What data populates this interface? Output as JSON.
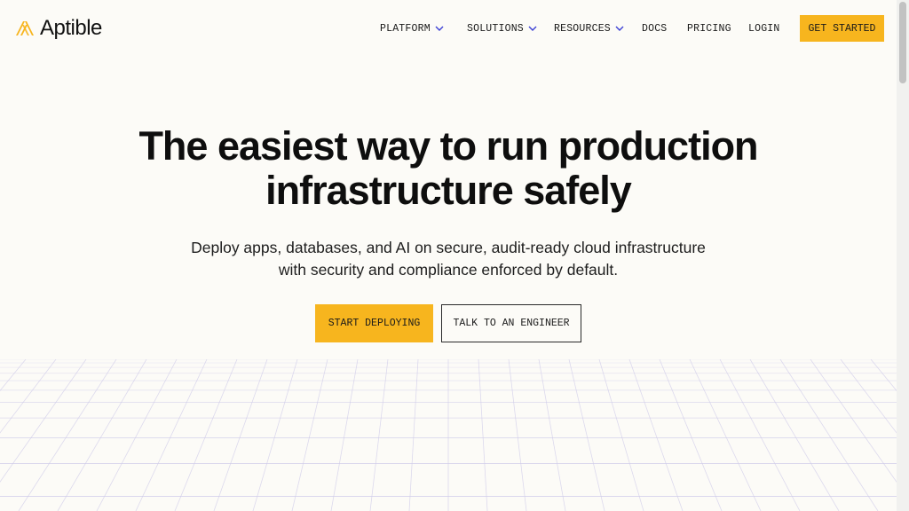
{
  "brand": {
    "name": "Aptible",
    "accent": "#f7b51e",
    "logo_icon": "aptible-logo-icon"
  },
  "nav": {
    "items": [
      {
        "label": "PLATFORM",
        "has_dropdown": true
      },
      {
        "label": "SOLUTIONS",
        "has_dropdown": true
      },
      {
        "label": "RESOURCES",
        "has_dropdown": true
      },
      {
        "label": "DOCS",
        "has_dropdown": false
      },
      {
        "label": "PRICING",
        "has_dropdown": false
      },
      {
        "label": "LOGIN",
        "has_dropdown": false
      }
    ],
    "cta": "GET STARTED",
    "dropdown_icon": "chevron-down-icon",
    "dropdown_color": "#3b3fd4"
  },
  "hero": {
    "headline_line1": "The easiest way to run production",
    "headline_line2": "infrastructure safely",
    "subtitle_line1": "Deploy apps, databases, and AI on secure, audit-ready cloud infrastructure",
    "subtitle_line2": "with security and compliance enforced by default.",
    "primary_cta": "START DEPLOYING",
    "secondary_cta": "TALK TO AN ENGINEER"
  }
}
